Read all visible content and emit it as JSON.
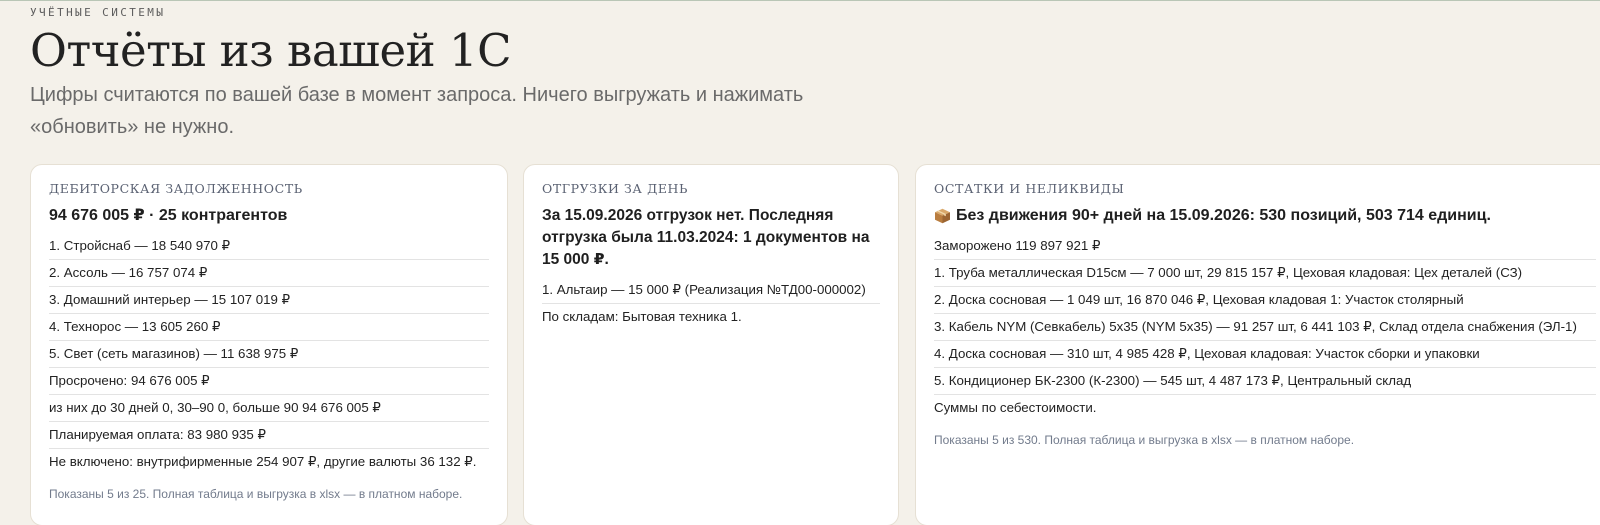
{
  "header": {
    "eyebrow": "УЧЁТНЫЕ СИСТЕМЫ",
    "title": "Отчёты из вашей 1С",
    "lead": "Цифры считаются по вашей базе в момент запроса. Ничего выгружать и нажимать «обновить» не нужно."
  },
  "receivables": {
    "label": "ДЕБИТОРСКАЯ ЗАДОЛЖЕННОСТЬ",
    "headline": "94 676 005 ₽ · 25 контрагентов",
    "rows": [
      "1. Стройснаб — 18 540 970 ₽",
      "2. Ассоль — 16 757 074 ₽",
      "3. Домашний интерьер — 15 107 019 ₽",
      "4. Технорос — 13 605 260 ₽",
      "5. Свет (сеть магазинов) — 11 638 975 ₽",
      "Просрочено: 94 676 005 ₽",
      "из них до 30 дней 0, 30–90 0, больше 90 94 676 005 ₽",
      "Планируемая оплата: 83 980 935 ₽",
      "Не включено: внутрифирменные 254 907 ₽, другие валюты 36 132 ₽."
    ],
    "footnote": "Показаны 5 из 25. Полная таблица и выгрузка в xlsx — в платном наборе."
  },
  "shipments": {
    "label": "ОТГРУЗКИ ЗА ДЕНЬ",
    "headline": "За 15.09.2026 отгрузок нет. Последняя отгрузка была 11.03.2024: 1 документов на 15 000 ₽.",
    "rows": [
      "1. Альтаир — 15 000 ₽ (Реализация №ТД00-000002)",
      "По складам: Бытовая техника 1."
    ]
  },
  "stock": {
    "label": "ОСТАТКИ И НЕЛИКВИДЫ",
    "icon": "package-icon",
    "headline": "Без движения 90+ дней на 15.09.2026: 530 позиций, 503 714 единиц.",
    "rows": [
      "Заморожено 119 897 921 ₽",
      "1. Труба металлическая D15см — 7 000 шт, 29 815 157 ₽, Цеховая кладовая: Цех деталей (СЗ)",
      "2. Доска сосновая — 1 049 шт, 16 870 046 ₽, Цеховая кладовая 1: Участок столярный",
      "3. Кабель NYM (Севкабель) 5х35 (NYM 5х35) — 91 257 шт, 6 441 103 ₽, Склад отдела снабжения (ЭЛ-1)",
      "4. Доска сосновая — 310 шт, 4 985 428 ₽, Цеховая кладовая: Участок сборки и упаковки",
      "5. Кондиционер БК-2300 (К-2300) — 545 шт, 4 487 173 ₽, Центральный склад",
      "Суммы по себестоимости."
    ],
    "footnote": "Показаны 5 из 530. Полная таблица и выгрузка в xlsx — в платном наборе."
  }
}
